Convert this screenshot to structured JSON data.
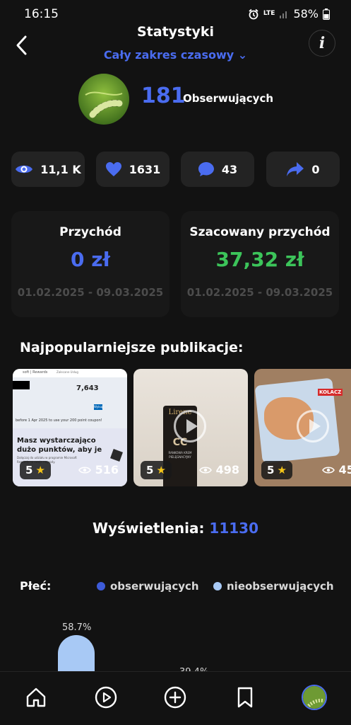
{
  "status_bar": {
    "time": "16:15",
    "network": "LTE",
    "battery": "58%"
  },
  "header": {
    "title": "Statystyki",
    "date_range": "Cały zakres czasowy ⌄"
  },
  "profile": {
    "followers_count": "181",
    "followers_label": "Obserwujących"
  },
  "stats": [
    {
      "icon": "eye-icon",
      "value": "11,1 K"
    },
    {
      "icon": "heart-icon",
      "value": "1631"
    },
    {
      "icon": "comment-icon",
      "value": "43"
    },
    {
      "icon": "share-icon",
      "value": "0"
    }
  ],
  "revenue": {
    "title": "Przychód",
    "value": "0 zł",
    "period": "01.02.2025 - 09.03.2025"
  },
  "estimated_revenue": {
    "title": "Szacowany przychód",
    "value": "37,32 zł",
    "period": "01.02.2025 - 09.03.2025"
  },
  "popular": {
    "title": "Najpopularniejsze publikacje:",
    "items": [
      {
        "rating": "5",
        "views": "516",
        "thumb_text": {
          "header_a": "soft | Rewards",
          "header_b": "Zalecane Usług",
          "points": "7,643",
          "button": "Wykup",
          "notice": "before 1 Apr 2025 to use your 200 point coupon!",
          "headline_1": "Masz wystarczająco",
          "headline_2": "dużo punktów, aby je",
          "sub_1": "Dołączaj do udziału w programie Microsoft",
          "sub_2": "Rewards na swoje nagrody."
        }
      },
      {
        "rating": "5",
        "views": "498",
        "thumb_text": {
          "brand": "Lirene",
          "mark": "CC",
          "label_1": "RANKOWA KREM",
          "label_2": "PIELĘGNACYJNY"
        }
      },
      {
        "rating": "5",
        "views": "458",
        "thumb_text": {
          "label": "KOLACZ"
        }
      }
    ]
  },
  "views": {
    "label": "Wyświetlenia:",
    "value": "11130"
  },
  "gender": {
    "label": "Płeć:",
    "legend": [
      {
        "name": "obserwujących",
        "color": "#3d5bd9"
      },
      {
        "name": "nieobserwujących",
        "color": "#a8c9f5"
      }
    ],
    "bar_label_1": "58.7%",
    "bar_label_2": "39.4%",
    "bar_value_1": 58.7
  },
  "colors": {
    "accent": "#4a6cf0",
    "green": "#3cc45a",
    "background": "#121212"
  },
  "nav": [
    "home-icon",
    "play-icon",
    "add-icon",
    "bookmark-icon",
    "profile-avatar"
  ]
}
